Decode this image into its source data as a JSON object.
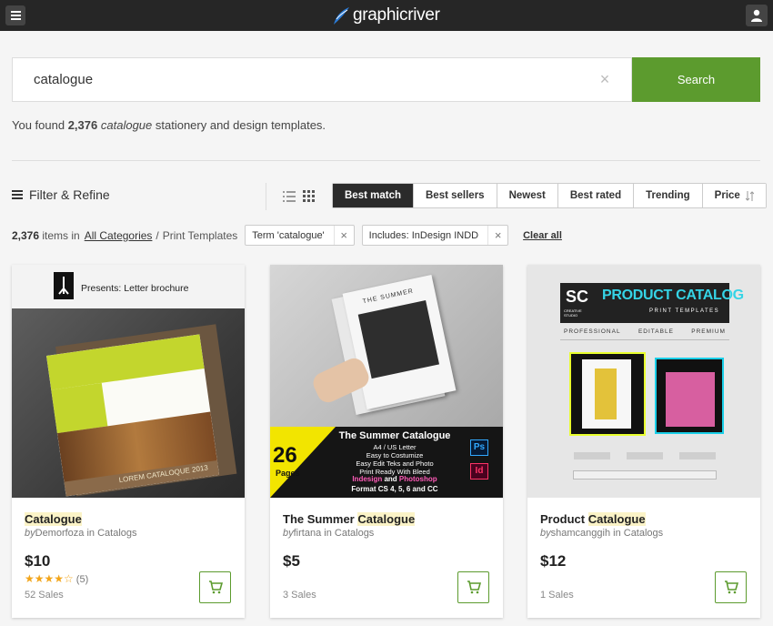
{
  "header": {
    "logo_text": "graphicriver"
  },
  "search": {
    "value": "catalogue",
    "button_label": "Search"
  },
  "results": {
    "prefix": "You found ",
    "count": "2,376",
    "term": "catalogue",
    "suffix": " stationery and design templates."
  },
  "filter": {
    "title": "Filter & Refine"
  },
  "sort": {
    "options": [
      "Best match",
      "Best sellers",
      "Newest",
      "Best rated",
      "Trending",
      "Price"
    ],
    "active": "Best match"
  },
  "crumbs": {
    "count": "2,376",
    "items_in": " items in",
    "category_link": "All Categories",
    "separator": "/",
    "subcategory": "Print Templates",
    "tags": [
      "Term 'catalogue'",
      "Includes: InDesign INDD"
    ],
    "clear_all": "Clear all"
  },
  "products": [
    {
      "title_highlight": "Catalogue",
      "title_suffix": "",
      "by": "by",
      "author": "Demorfoza",
      "in": " in ",
      "category": "Catalogs",
      "price": "$10",
      "stars": 4,
      "rating_count": "(5)",
      "sales": "52 Sales",
      "thumb": {
        "header": "Presents: Letter brochure",
        "cover_text": "LOREM CATALOQUE 2013"
      }
    },
    {
      "title_prefix": "The Summer ",
      "title_highlight": "Catalogue",
      "by": "by",
      "author": "firtana",
      "in": " in ",
      "category": "Catalogs",
      "price": "$5",
      "sales": "3 Sales",
      "thumb": {
        "mag_title": "THE SUMMER",
        "big_number": "26",
        "pages": "Pages",
        "banner_title": "The Summer Catalogue",
        "lines": [
          "A4 / US Letter",
          "Easy to Costumize",
          "Easy Edit Teks and Photo",
          "Print Ready With Bleed"
        ],
        "software_line_a": "Indesign",
        "software_and": " and ",
        "software_line_b": "Photoshop",
        "format": "Format CS 4, 5, 6 and CC",
        "badge_ps": "Ps",
        "badge_id": "Id"
      }
    },
    {
      "title_prefix": "Product ",
      "title_highlight": "Catalogue",
      "by": "by",
      "author": "shamcanggih",
      "in": " in ",
      "category": "Catalogs",
      "price": "$12",
      "sales": "1 Sales",
      "thumb": {
        "mark": "SC",
        "mark_sub": "CREATIVE STUDIO",
        "title": "PRODUCT CATALOG",
        "subtitle": "PRINT TEMPLATES",
        "tags": [
          "PROFESSIONAL",
          "EDITABLE",
          "PREMIUM"
        ]
      }
    }
  ],
  "colors": {
    "accent": "#5c9b2e",
    "header": "#262626",
    "highlight": "#fbf3c7",
    "star": "#f2a51a"
  }
}
